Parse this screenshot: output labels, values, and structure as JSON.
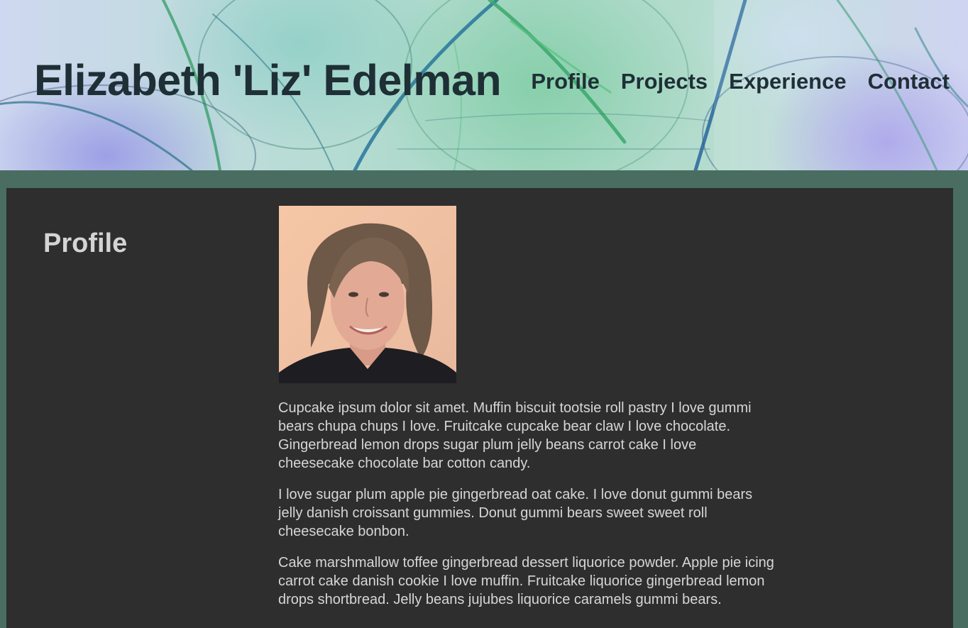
{
  "header": {
    "title": "Elizabeth 'Liz' Edelman",
    "nav": [
      "Profile",
      "Projects",
      "Experience",
      "Contact"
    ]
  },
  "profile": {
    "heading": "Profile",
    "paragraphs": [
      "Cupcake ipsum dolor sit amet. Muffin biscuit tootsie roll pastry I love gummi bears chupa chups I love. Fruitcake cupcake bear claw I love chocolate. Gingerbread lemon drops sugar plum jelly beans carrot cake I love cheesecake chocolate bar cotton candy.",
      "I love sugar plum apple pie gingerbread oat cake. I love donut gummi bears jelly danish croissant gummies. Donut gummi bears sweet sweet roll cheesecake bonbon.",
      "Cake marshmallow toffee gingerbread dessert liquorice powder. Apple pie icing carrot cake danish cookie I love muffin. Fruitcake liquorice gingerbread lemon drops shortbread. Jelly beans jujubes liquorice caramels gummi bears."
    ]
  },
  "colors": {
    "page_background": "#4a6d61",
    "panel_background": "#2d2e2d",
    "header_text": "#1f2f36",
    "body_text": "#d6d6d6"
  }
}
